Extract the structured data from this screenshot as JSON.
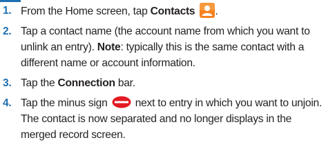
{
  "steps": [
    {
      "number": "1.",
      "text_before": "From the Home screen, tap ",
      "bold": "Contacts",
      "text_after": " ",
      "icon": "contacts-app-icon",
      "text_end": "."
    },
    {
      "number": "2.",
      "text_before": "Tap a contact name (the account name from which you want to unlink an entry). ",
      "bold": "Note",
      "text_after": ": typically this is the same contact with a different name or account information."
    },
    {
      "number": "3.",
      "text_before": "Tap the ",
      "bold": "Connection",
      "text_after": " bar."
    },
    {
      "number": "4.",
      "text_before": "Tap the minus sign ",
      "icon": "minus-circle-icon",
      "text_after": " next to entry in which you want to unjoin. The contact is now separated and no longer displays in the merged record screen."
    }
  ],
  "colors": {
    "step_number": "#1f6fb2",
    "text": "#231f20",
    "contacts_icon_bg": "#f58220",
    "minus_icon": "#e31b23"
  }
}
